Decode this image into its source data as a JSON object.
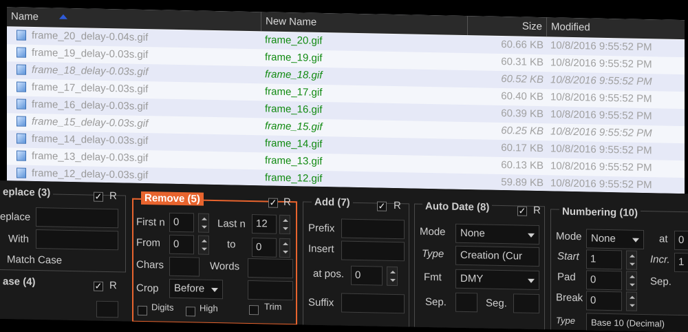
{
  "columns": {
    "name": "Name",
    "new_name": "New Name",
    "size": "Size",
    "modified": "Modified"
  },
  "files": [
    {
      "name": "frame_20_delay-0.04s.gif",
      "new_name": "frame_20.gif",
      "size": "60.66 KB",
      "modified": "10/8/2016 9:55:52 PM",
      "selected": true,
      "italic": false
    },
    {
      "name": "frame_19_delay-0.03s.gif",
      "new_name": "frame_19.gif",
      "size": "60.31 KB",
      "modified": "10/8/2016 9:55:52 PM",
      "selected": false,
      "italic": false
    },
    {
      "name": "frame_18_delay-0.03s.gif",
      "new_name": "frame_18.gif",
      "size": "60.52 KB",
      "modified": "10/8/2016 9:55:52 PM",
      "selected": true,
      "italic": true
    },
    {
      "name": "frame_17_delay-0.03s.gif",
      "new_name": "frame_17.gif",
      "size": "60.40 KB",
      "modified": "10/8/2016 9:55:52 PM",
      "selected": false,
      "italic": false
    },
    {
      "name": "frame_16_delay-0.03s.gif",
      "new_name": "frame_16.gif",
      "size": "60.39 KB",
      "modified": "10/8/2016 9:55:52 PM",
      "selected": true,
      "italic": false
    },
    {
      "name": "frame_15_delay-0.03s.gif",
      "new_name": "frame_15.gif",
      "size": "60.25 KB",
      "modified": "10/8/2016 9:55:52 PM",
      "selected": false,
      "italic": true
    },
    {
      "name": "frame_14_delay-0.03s.gif",
      "new_name": "frame_14.gif",
      "size": "60.17 KB",
      "modified": "10/8/2016 9:55:52 PM",
      "selected": true,
      "italic": false
    },
    {
      "name": "frame_13_delay-0.03s.gif",
      "new_name": "frame_13.gif",
      "size": "60.13 KB",
      "modified": "10/8/2016 9:55:52 PM",
      "selected": false,
      "italic": false
    },
    {
      "name": "frame_12_delay-0.03s.gif",
      "new_name": "frame_12.gif",
      "size": "59.89 KB",
      "modified": "10/8/2016 9:55:52 PM",
      "selected": true,
      "italic": false
    }
  ],
  "replace": {
    "title": "eplace (3)",
    "replace_label": "eplace",
    "with_label": "With",
    "match_case": "Match Case",
    "r": "R"
  },
  "case": {
    "title": "ase (4)",
    "r": "R"
  },
  "remove": {
    "title": "Remove (5)",
    "first_n": "First n",
    "first_n_val": "0",
    "last_n": "Last n",
    "last_n_val": "12",
    "from": "From",
    "from_val": "0",
    "to": "to",
    "to_val": "0",
    "chars": "Chars",
    "words": "Words",
    "crop": "Crop",
    "crop_val": "Before",
    "digits": "Digits",
    "high": "High",
    "trim": "Trim",
    "r": "R"
  },
  "add": {
    "title": "Add (7)",
    "prefix": "Prefix",
    "insert": "Insert",
    "at_pos": "at pos.",
    "at_pos_val": "0",
    "suffix": "Suffix",
    "r": "R"
  },
  "autodate": {
    "title": "Auto Date (8)",
    "mode": "Mode",
    "mode_val": "None",
    "type": "Type",
    "type_val": "Creation (Cur",
    "fmt": "Fmt",
    "fmt_val": "DMY",
    "sep": "Sep.",
    "seg": "Seg.",
    "r": "R"
  },
  "numbering": {
    "title": "Numbering (10)",
    "mode": "Mode",
    "mode_val": "None",
    "at": "at",
    "at_val": "0",
    "start": "Start",
    "start_val": "1",
    "incr": "Incr.",
    "incr_val": "1",
    "pad": "Pad",
    "pad_val": "0",
    "sep": "Sep.",
    "break": "Break",
    "break_val": "0",
    "type": "Type",
    "type_val": "Base 10 (Decimal)"
  },
  "colors": {
    "accent": "#e8642e",
    "new_name_green": "#118a11",
    "list_bg": "#f4f6fb",
    "panel_bg": "#1a1a1a"
  }
}
